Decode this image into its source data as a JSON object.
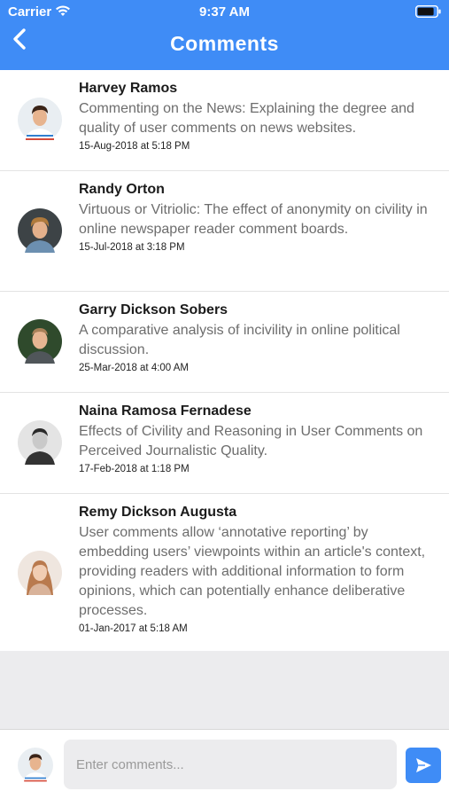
{
  "status_bar": {
    "carrier": "Carrier",
    "time": "9:37 AM"
  },
  "header": {
    "title": "Comments"
  },
  "comments": [
    {
      "name": "Harvey Ramos",
      "text": "Commenting on the News: Explaining the degree and quality of user comments on news websites.",
      "time": "15-Aug-2018 at 5:18 PM"
    },
    {
      "name": "Randy Orton",
      "text": "Virtuous or Vitriolic: The effect of anonymity on civility in online newspaper reader comment boards.",
      "time": "15-Jul-2018 at 3:18 PM"
    },
    {
      "name": "Garry Dickson Sobers",
      "text": "A comparative analysis of incivility in online political discussion.",
      "time": "25-Mar-2018 at 4:00 AM"
    },
    {
      "name": "Naina Ramosa Fernadese",
      "text": "Effects of Civility and Reasoning in User Comments on Perceived Journalistic Quality.",
      "time": "17-Feb-2018 at 1:18 PM"
    },
    {
      "name": "Remy Dickson Augusta",
      "text": "User comments allow ‘annotative reporting’ by embedding users’ viewpoints within an article's context, providing readers with additional information to form opinions, which can potentially enhance deliberative processes.",
      "time": "01-Jan-2017 at 5:18 AM"
    }
  ],
  "composer": {
    "placeholder": "Enter comments..."
  },
  "colors": {
    "accent": "#3f8cf6",
    "background_gray": "#ececee"
  },
  "icons": [
    "wifi-icon",
    "battery-icon",
    "back-chevron-icon",
    "send-icon",
    "avatar"
  ]
}
